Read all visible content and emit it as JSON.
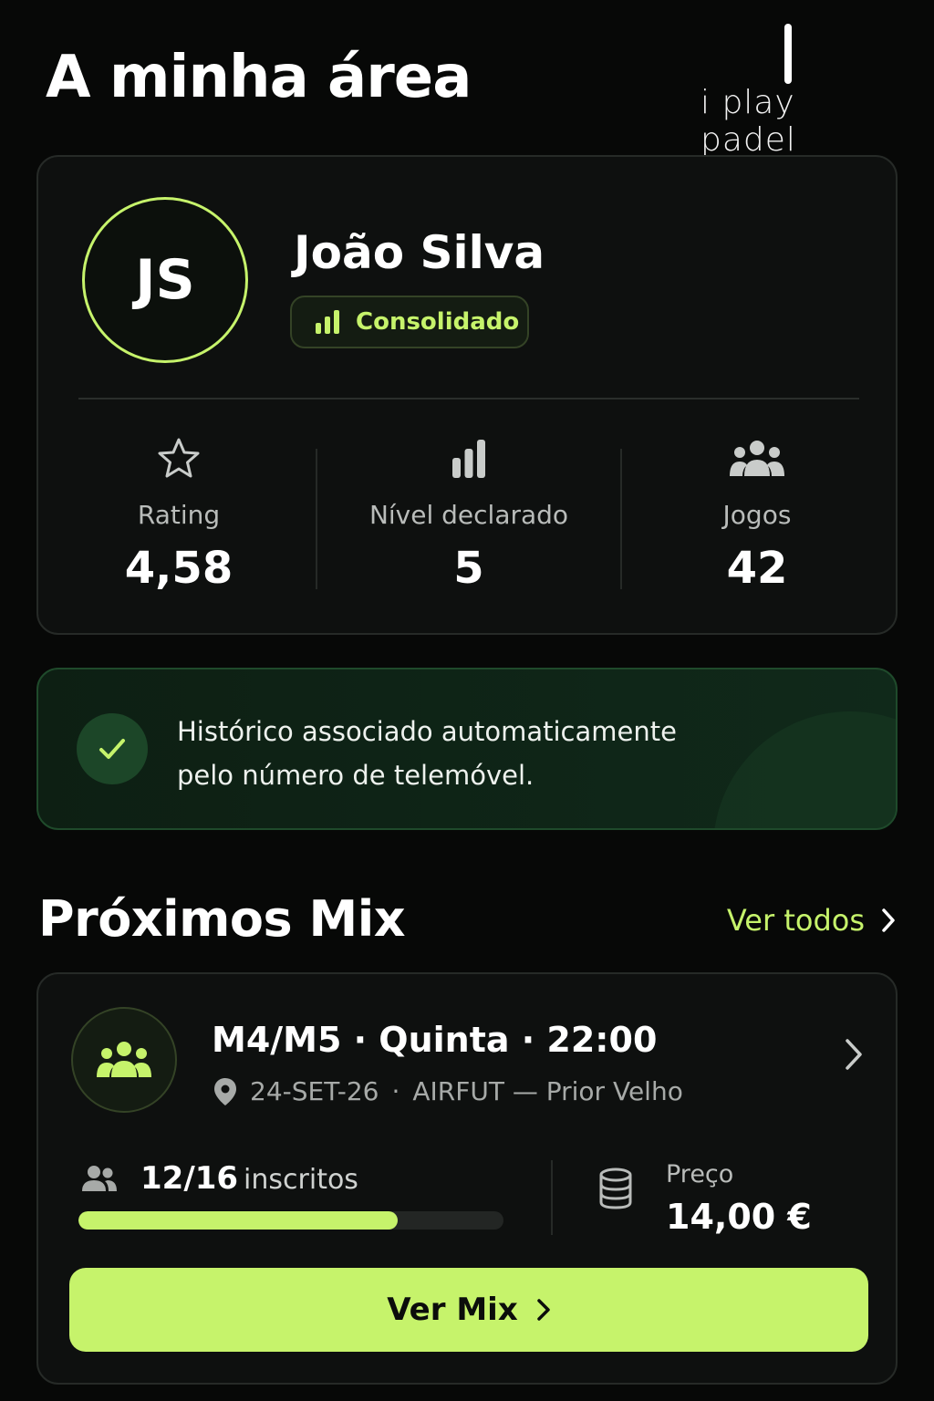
{
  "header": {
    "title": "A minha área",
    "logo_text": "i play padel"
  },
  "profile": {
    "initials": "JS",
    "name": "João Silva",
    "badge": "Consolidado",
    "stats": [
      {
        "label": "Rating",
        "value": "4,58",
        "icon": "star-icon"
      },
      {
        "label": "Nível declarado",
        "value": "5",
        "icon": "bar-chart-icon"
      },
      {
        "label": "Jogos",
        "value": "42",
        "icon": "people-group-icon"
      }
    ]
  },
  "info": {
    "line1": "Histórico associado automaticamente",
    "line2": "pelo número de telemóvel.",
    "icon": "check-icon"
  },
  "section": {
    "title": "Próximos Mix",
    "see_all": "Ver todos"
  },
  "mix": {
    "title": "M4/M5 · Quinta · 22:00",
    "date": "24-SET-26",
    "separator": "·",
    "location": "AIRFUT — Prior Velho",
    "registered_count": "12/16",
    "registered_word": "inscritos",
    "registered_fraction": 0.75,
    "price_label": "Preço",
    "price_value": "14,00 €",
    "cta_label": "Ver Mix"
  },
  "colors": {
    "accent": "#c6f36b",
    "background": "#070807",
    "card": "#0e100f",
    "success_bg": "#0d1f13"
  }
}
